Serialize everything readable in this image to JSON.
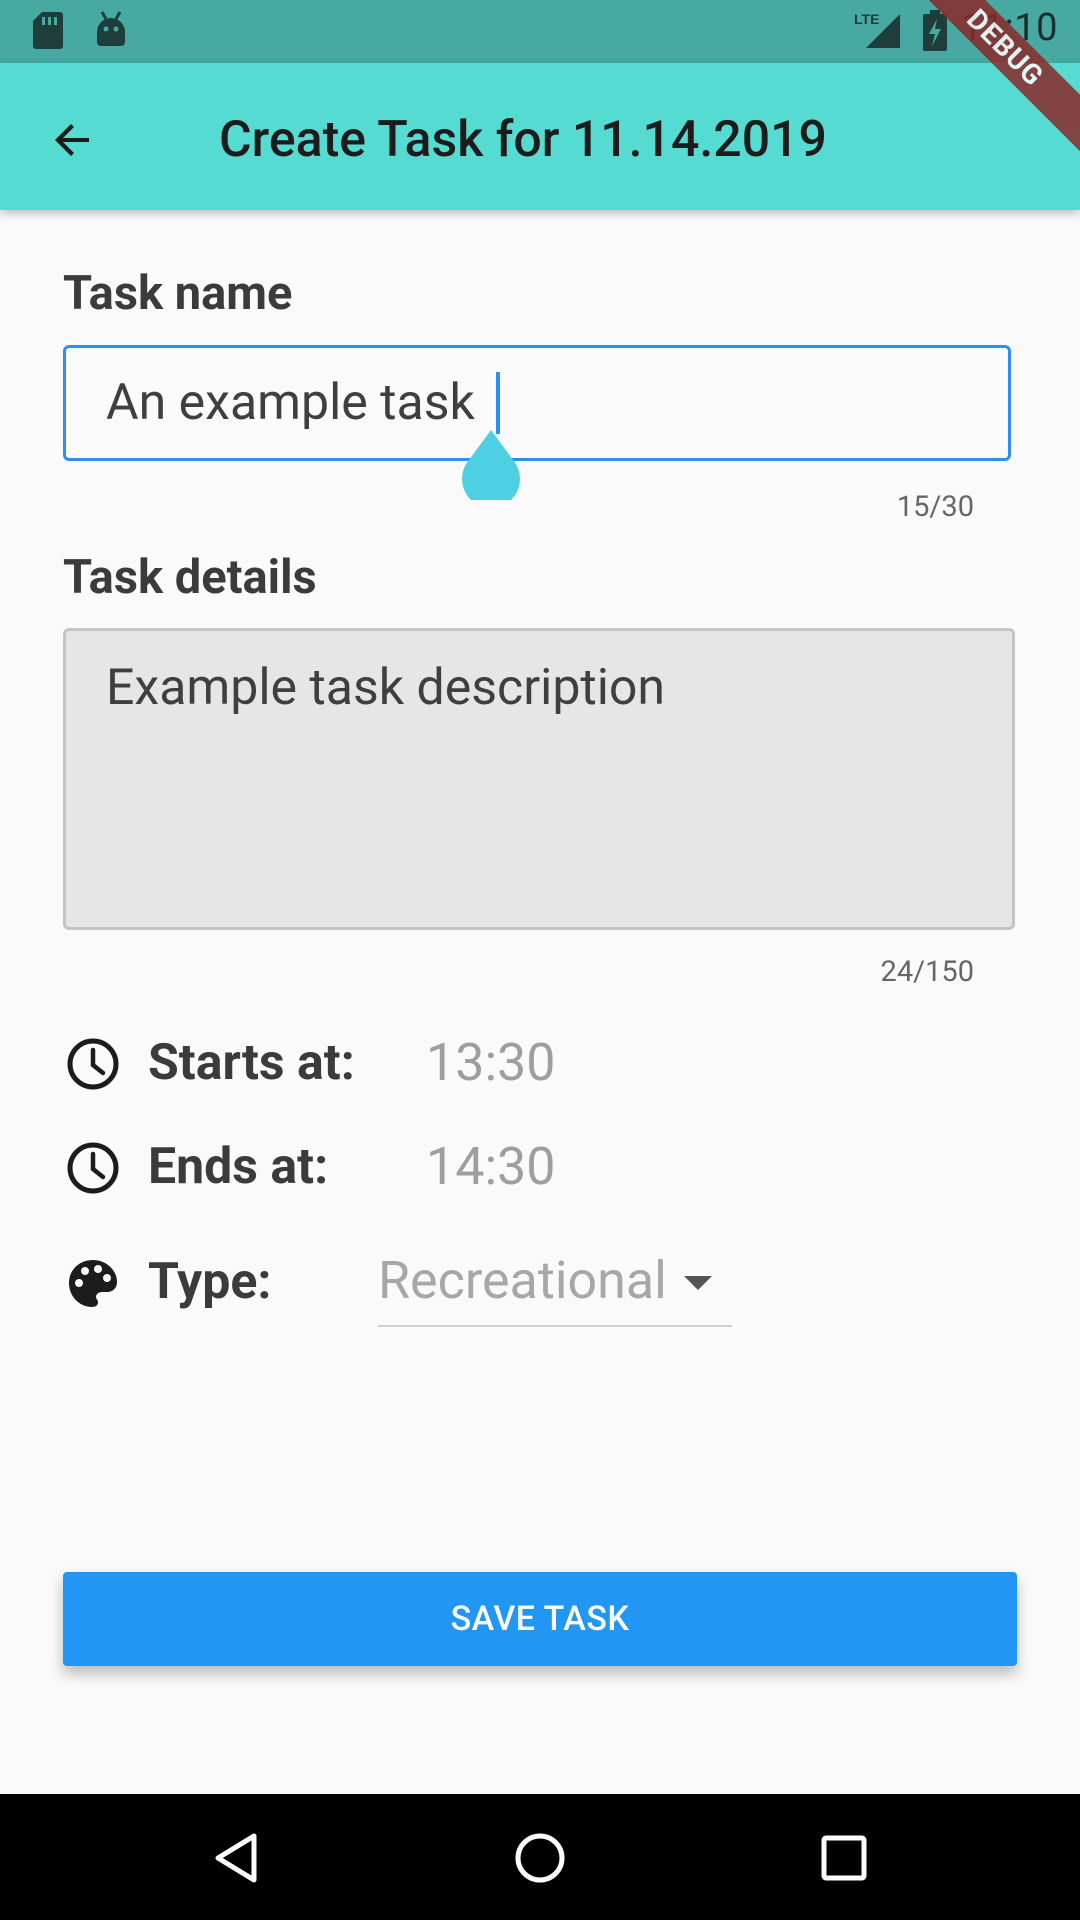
{
  "status_bar": {
    "time": "11:10",
    "icons": [
      "sd-card-icon",
      "android-icon",
      "lte-signal-icon",
      "battery-charging-icon"
    ]
  },
  "debug_banner": "DEBUG",
  "app_bar": {
    "title": "Create Task for 11.14.2019",
    "back_icon": "arrow-back-icon",
    "background": "#55dbd1"
  },
  "form": {
    "task_name": {
      "label": "Task name",
      "value": "An example task",
      "counter": "15/30",
      "border_color": "#2d8ff0"
    },
    "task_details": {
      "label": "Task details",
      "value": "Example task description",
      "counter": "24/150"
    },
    "starts_at": {
      "label": "Starts at:",
      "value": "13:30",
      "icon": "clock-icon"
    },
    "ends_at": {
      "label": "Ends at:",
      "value": "14:30",
      "icon": "clock-icon"
    },
    "type": {
      "label": "Type:",
      "value": "Recreational",
      "icon": "palette-icon"
    }
  },
  "save_button": {
    "label": "SAVE TASK",
    "color": "#2196f3"
  },
  "nav_bar": {
    "buttons": [
      "back-triangle-icon",
      "home-circle-icon",
      "recents-square-icon"
    ]
  }
}
